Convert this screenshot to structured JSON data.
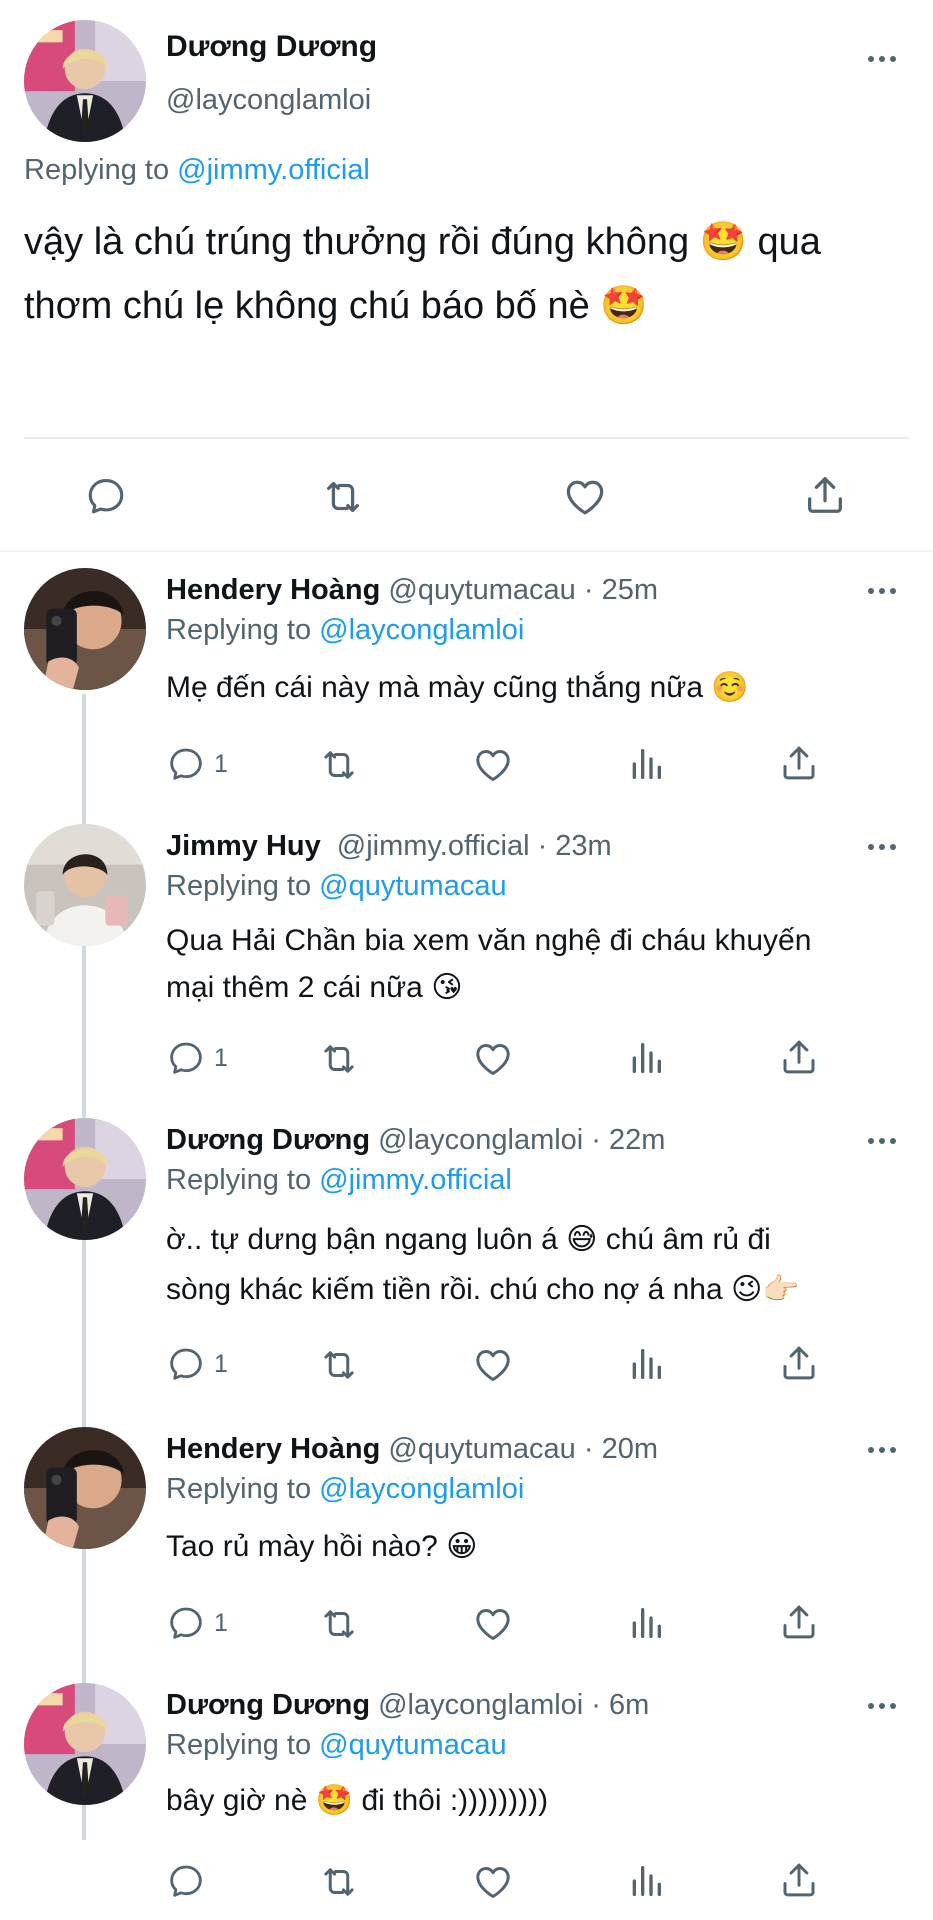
{
  "main_tweet": {
    "author_name": "Dương Dương",
    "author_handle": "@layconglamloi",
    "replying_prefix": "Replying to",
    "replying_to": "@jimmy.official",
    "line1": "vậy là chú trúng thưởng rồi đúng không 🤩 qua",
    "line2": "thơm chú lẹ không chú báo bố nè 🤩"
  },
  "replies": [
    {
      "name": "Hendery Hoàng",
      "meta": "@quytumacau · 25m",
      "replying_prefix": "Replying to",
      "replying_to": "@layconglamloi",
      "line1": "Mẹ đến cái này mà mày cũng thắng nữa ☺️",
      "line2": "",
      "reply_count": "1"
    },
    {
      "name": "Jimmy Huy",
      "meta": "@jimmy.official · 23m",
      "replying_prefix": "Replying to",
      "replying_to": "@quytumacau",
      "line1": "Qua Hải Chần bia xem văn nghệ đi cháu khuyến",
      "line2": "mại thêm 2 cái nữa 😘",
      "reply_count": "1"
    },
    {
      "name": "Dương Dương",
      "meta": "@layconglamloi · 22m",
      "replying_prefix": "Replying to",
      "replying_to": "@jimmy.official",
      "line1": "ờ.. tự dưng bận ngang luôn á 😅 chú âm rủ đi",
      "line2": "sòng khác kiếm tiền rồi. chú cho nợ á nha 😉👉🏻",
      "reply_count": "1"
    },
    {
      "name": "Hendery Hoàng",
      "meta": "@quytumacau · 20m",
      "replying_prefix": "Replying to",
      "replying_to": "@layconglamloi",
      "line1": "Tao rủ mày hồi nào? 😀",
      "line2": "",
      "reply_count": "1"
    },
    {
      "name": "Dương Dương",
      "meta": "@layconglamloi · 6m",
      "replying_prefix": "Replying to",
      "replying_to": "@quytumacau",
      "line1": "bây giờ nè 🤩 đi thôi :)))))))))",
      "line2": "",
      "reply_count": ""
    }
  ],
  "icons": {
    "reply": "reply-icon",
    "retweet": "retweet-icon",
    "like": "heart-icon",
    "views": "analytics-icon",
    "share": "share-icon",
    "more": "more-icon"
  },
  "colors": {
    "link": "#1d9bf0",
    "text": "#0f1419",
    "secondary": "#536471",
    "thread_line": "#cfd9de"
  }
}
